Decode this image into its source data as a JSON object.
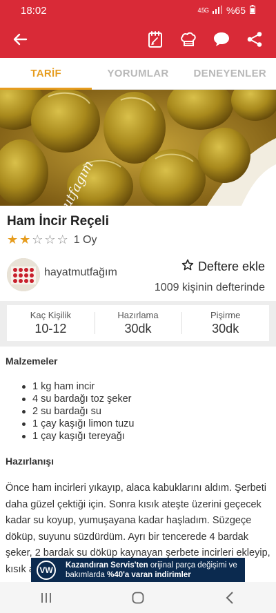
{
  "status": {
    "time": "18:02",
    "network": "4.5G",
    "battery": "%65"
  },
  "app_bar": {
    "back_icon": "arrow-left-icon",
    "actions": [
      "notebook-icon",
      "chef-hat-icon",
      "chat-bubble-icon",
      "share-icon"
    ]
  },
  "tabs": [
    {
      "label": "TARİF",
      "active": true
    },
    {
      "label": "YORUMLAR",
      "active": false
    },
    {
      "label": "DENEYENLER",
      "active": false
    }
  ],
  "hero": {
    "watermark": "hayatmutfagım"
  },
  "recipe": {
    "title": "Ham İncir Reçeli",
    "rating": {
      "filled": 2,
      "total": 5,
      "votes": "1 Oy"
    }
  },
  "author": {
    "name": "hayatmutfağım",
    "add_label": "Deftere ekle",
    "notebook_count": "1009 kişinin defterinde"
  },
  "info": [
    {
      "label": "Kaç Kişilik",
      "value": "10-12"
    },
    {
      "label": "Hazırlama",
      "value": "30dk"
    },
    {
      "label": "Pişirme",
      "value": "30dk"
    }
  ],
  "ingredients_title": "Malzemeler",
  "ingredients": [
    "1 kg ham incir",
    "4 su bardağı toz şeker",
    "2 su bardağı su",
    "1 çay kaşığı limon tuzu",
    "1 çay kaşığı tereyağı"
  ],
  "preparation_title": "Hazırlanışı",
  "preparation": "Önce ham incirleri yıkayıp, alaca kabuklarını aldım. Şerbeti daha güzel çektiği için. Sonra kısık ateşte üzerini geçecek kadar su koyup, yumuşayana kadar haşladım. Süzgeçe döküp, suyunu süzdürdüm. Ayrı bir tencerede 4 bardak şeker, 2 bardak su döküp kaynayan şerbete incirleri ekleyip, kısık ateşte pişirdim.",
  "ad": {
    "bold": "Kazandıran Servis'ten",
    "text": " orijinal parça değişimi ve bakımlarda ",
    "highlight": "%40'a varan indirimler"
  },
  "colors": {
    "brand": "#d92a37",
    "accent": "#e69c1e"
  }
}
